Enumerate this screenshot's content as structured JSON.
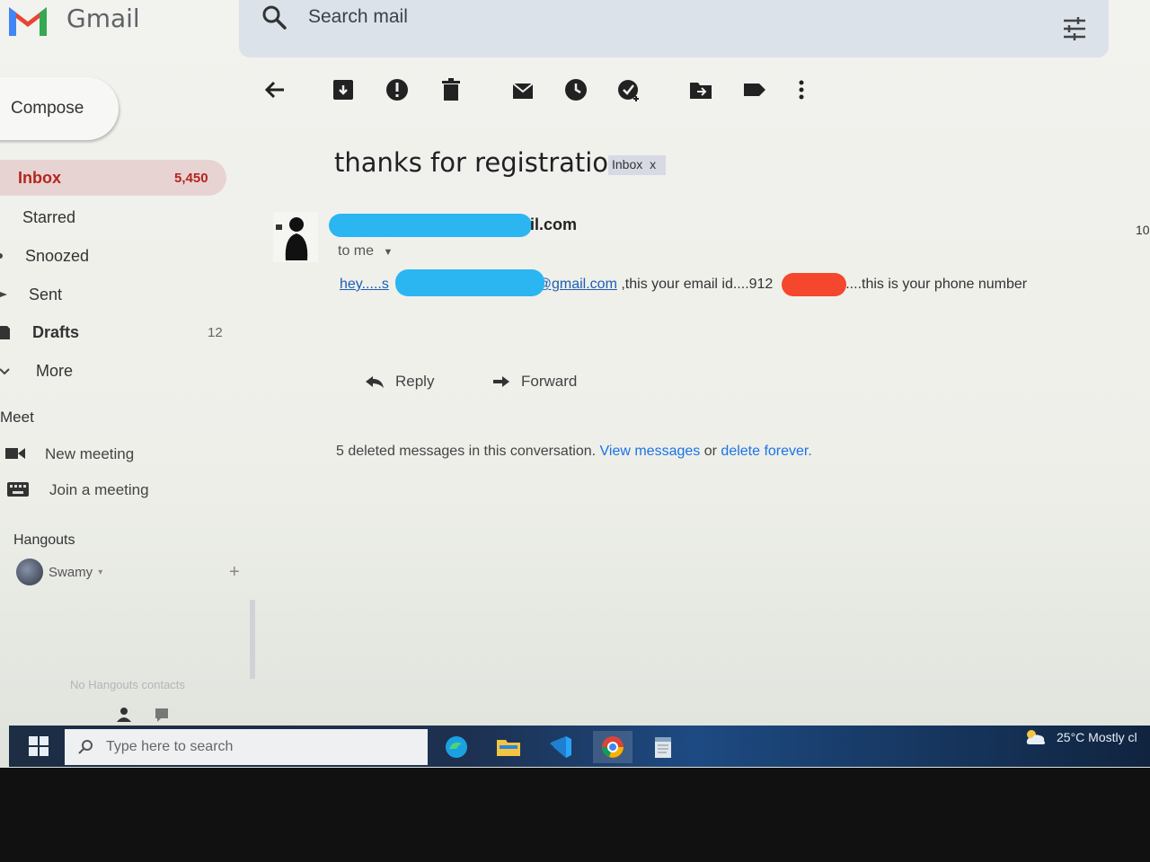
{
  "header": {
    "app_title": "Gmail",
    "search_placeholder": "Search mail"
  },
  "sidebar": {
    "compose_label": "Compose",
    "items": [
      {
        "label": "Inbox",
        "count": "5,450"
      },
      {
        "label": "Starred",
        "count": ""
      },
      {
        "label": "Snoozed",
        "count": ""
      },
      {
        "label": "Sent",
        "count": ""
      },
      {
        "label": "Drafts",
        "count": "12"
      },
      {
        "label": "More",
        "count": ""
      }
    ],
    "meet": {
      "title": "Meet",
      "new_meeting": "New meeting",
      "join_meeting": "Join a meeting"
    },
    "hangouts": {
      "title": "Hangouts",
      "user": "Swamy",
      "no_contacts": "No Hangouts contacts"
    }
  },
  "email": {
    "subject": "thanks for registration",
    "label_chip": "Inbox",
    "label_chip_close": "x",
    "sender_suffix": "il.com",
    "to_line": "to me",
    "body": {
      "greeting_link": "hey.....s",
      "email_link": "@gmail.com",
      "text_1": ",this your email id....912",
      "text_2": "....this is your phone number"
    },
    "reply_label": "Reply",
    "forward_label": "Forward",
    "deleted_note": {
      "text": "5 deleted messages in this conversation.",
      "view_link": "View messages",
      "or": "or",
      "delete_link": "delete forever."
    },
    "edge_number": "10"
  },
  "taskbar": {
    "search_placeholder": "Type here to search",
    "weather": "25°C  Mostly cl"
  },
  "colors": {
    "inbox_active_bg": "#e8d3d3",
    "inbox_text": "#b3261e",
    "link": "#1a73e8",
    "redaction_blue": "#2bb6f2",
    "redaction_red": "#f4472e"
  }
}
